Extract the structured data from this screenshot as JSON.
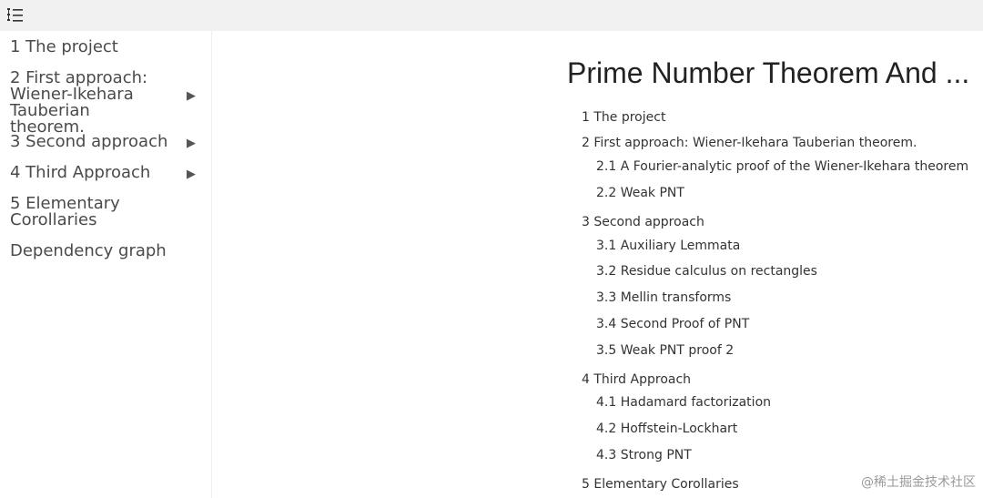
{
  "sidebar": {
    "items": [
      {
        "label": "1 The project"
      },
      {
        "label": "2 First approach: Wiener-Ikehara Tauberian theorem.",
        "arrow": "▶"
      },
      {
        "label": "3 Second approach",
        "arrow": "▶"
      },
      {
        "label": "4 Third Approach",
        "arrow": "▶"
      },
      {
        "label": "5 Elementary Corollaries"
      },
      {
        "label": "Dependency graph"
      }
    ]
  },
  "main": {
    "title": "Prime Number Theorem And ...",
    "toc": [
      "1 The project",
      "2 First approach: Wiener-Ikehara Tauberian theorem.",
      "2.1 A Fourier-analytic proof of the Wiener-Ikehara theorem",
      "2.2 Weak PNT",
      "3 Second approach",
      "3.1 Auxiliary Lemmata",
      "3.2 Residue calculus on rectangles",
      "3.3 Mellin transforms",
      "3.4 Second Proof of PNT",
      "3.5 Weak PNT proof 2",
      "4 Third Approach",
      "4.1 Hadamard factorization",
      "4.2 Hoffstein-Lockhart",
      "4.3 Strong PNT",
      "5 Elementary Corollaries"
    ]
  },
  "watermark": "@稀土掘金技术社区",
  "icons": {
    "toc_toggle": "list-toggle-icon",
    "expand": "triangle-right-icon"
  }
}
